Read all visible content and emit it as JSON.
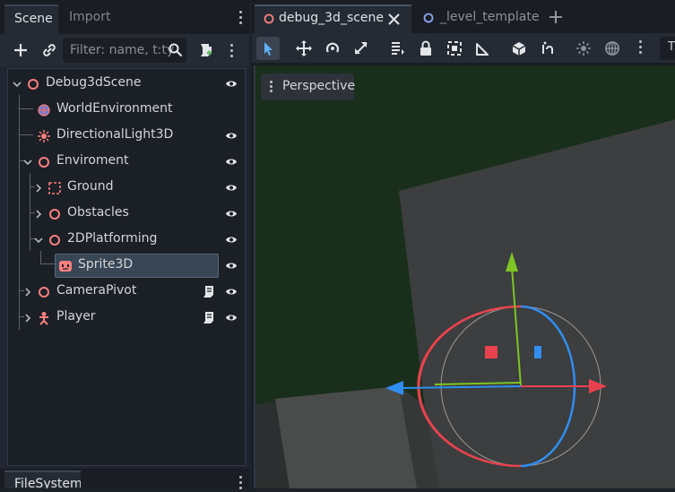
{
  "left_dock": {
    "tabs": [
      "Scene",
      "Import"
    ],
    "filter_placeholder": "Filter: name, t:ty",
    "bottom_tab": "FileSystem"
  },
  "scene_tree": {
    "nodes": [
      {
        "label": "Debug3dScene",
        "icon": "node3d-icon",
        "expanded": true,
        "visible": true
      },
      {
        "label": "WorldEnvironment",
        "icon": "world-environment-icon"
      },
      {
        "label": "DirectionalLight3D",
        "icon": "directional-light-icon",
        "visible": true
      },
      {
        "label": "Enviroment",
        "icon": "node3d-icon",
        "expanded": true,
        "visible": true
      },
      {
        "label": "Ground",
        "icon": "gridmap-icon",
        "expanded": false,
        "visible": true
      },
      {
        "label": "Obstacles",
        "icon": "node3d-icon",
        "expanded": false,
        "visible": true
      },
      {
        "label": "2DPlatforming",
        "icon": "node3d-icon",
        "expanded": true,
        "visible": true
      },
      {
        "label": "Sprite3D",
        "icon": "sprite3d-icon",
        "selected": true,
        "visible": true
      },
      {
        "label": "CameraPivot",
        "icon": "node3d-icon",
        "expanded": false,
        "visible": true,
        "has_script": true
      },
      {
        "label": "Player",
        "icon": "character-icon",
        "expanded": false,
        "visible": true,
        "has_script": true
      }
    ]
  },
  "editor": {
    "tabs": [
      {
        "label": "debug_3d_scene",
        "active": true
      },
      {
        "label": "_level_template",
        "active": false
      }
    ],
    "toolbar_icons": [
      "select-icon",
      "move-icon",
      "rotate-icon",
      "scale-icon",
      "list-icon",
      "lock-icon",
      "group-icon",
      "ruler-icon",
      "snap-icon",
      "local-space-icon",
      "sun-icon",
      "environment-icon",
      "more-icon"
    ],
    "toolbar_overflow_text": "T",
    "viewport": {
      "perspective_label": "Perspective"
    }
  },
  "colors": {
    "node_red": "#fc7f7f",
    "axis_x": "#e8424f",
    "axis_y": "#7fc424",
    "axis_z": "#2f8ef0",
    "selection": "#384656"
  }
}
